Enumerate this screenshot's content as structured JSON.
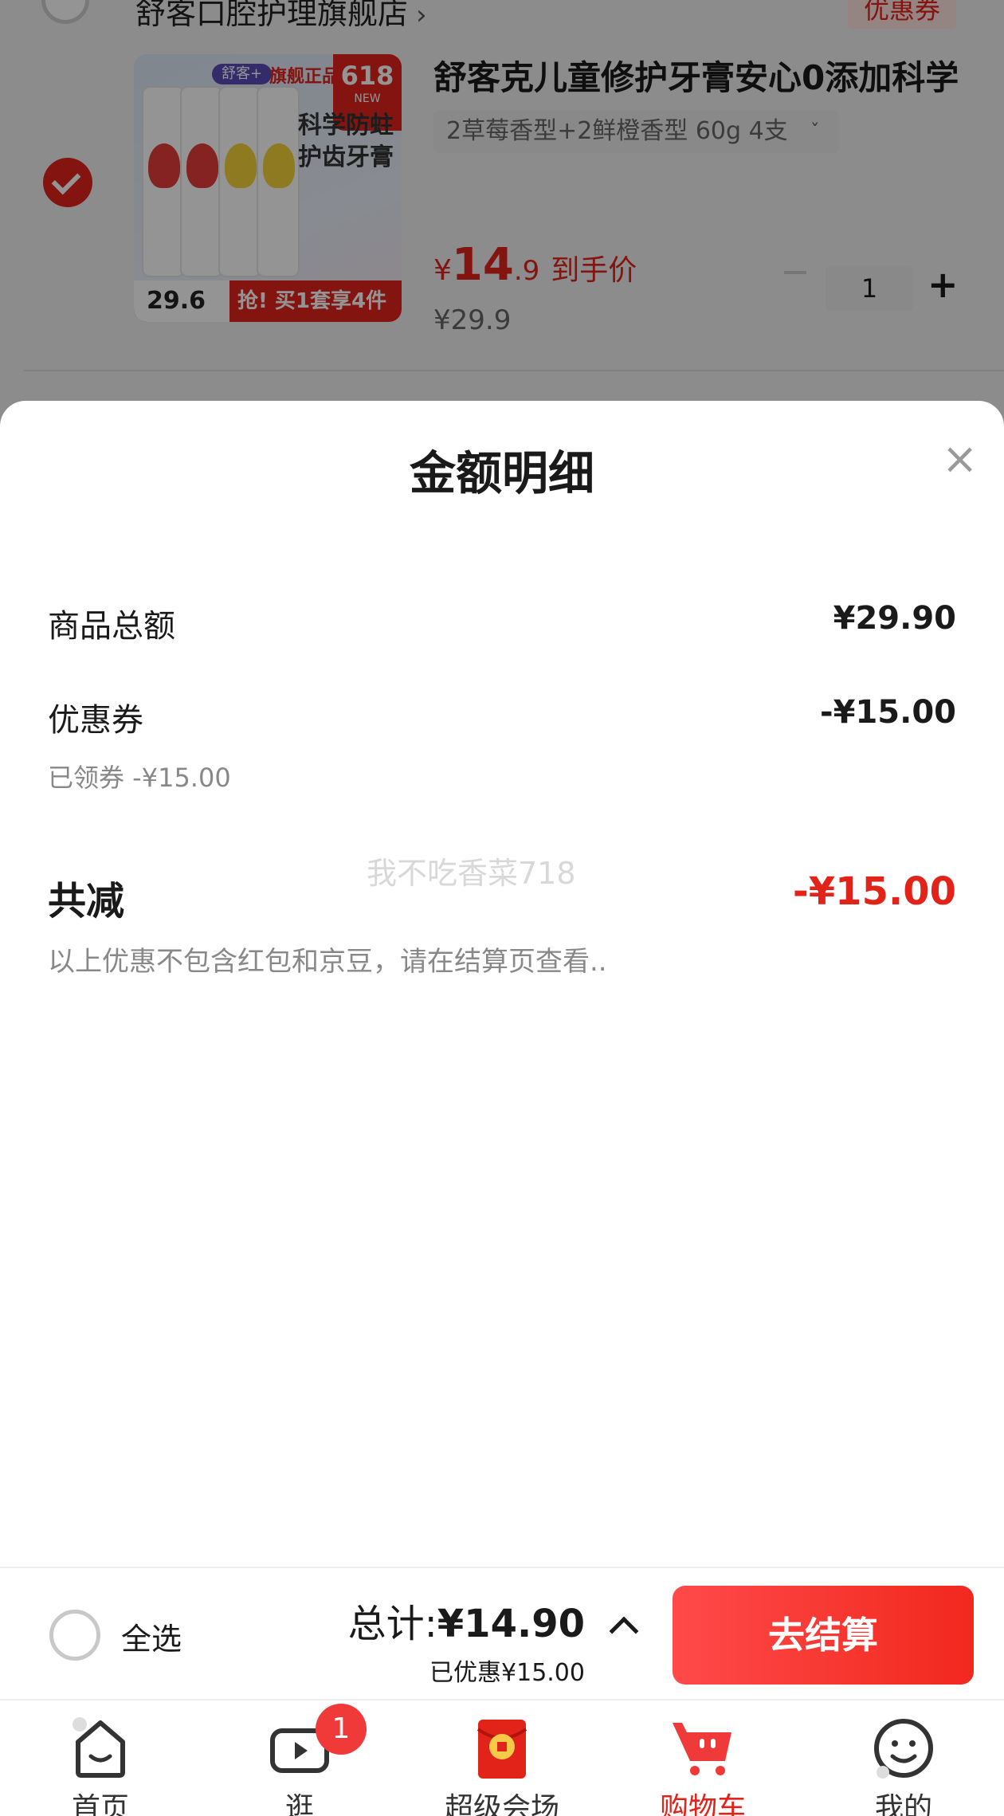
{
  "cart": {
    "store_name": "舒客口腔护理旗舰店",
    "store_arrow": "›",
    "coupon_tag": "优惠券",
    "product": {
      "title": "舒客克儿童修护牙膏安心0添加科学",
      "spec": "2草莓香型+2鲜橙香型 60g 4支",
      "spec_chevron": "ˇ",
      "price_yen": "¥",
      "price_int": "14",
      "price_dec": ".9",
      "price_label": "到手价",
      "original_price": "¥29.9",
      "quantity": "1",
      "qty_plus": "+",
      "image": {
        "badge_618": "618",
        "badge_new": "NEW",
        "brand_tag": "舒客+",
        "official_tag": "旗舰正品",
        "slogan": "科学防蛀护齿牙膏",
        "bottom_price": "29.6",
        "bottom_promo": "抢! 买1套享4件"
      }
    }
  },
  "sheet": {
    "title": "金额明细",
    "close_icon": "×",
    "lines": [
      {
        "label": "商品总额",
        "value": "¥29.90"
      },
      {
        "label": "优惠券",
        "value": "-¥15.00",
        "note": "已领券 -¥15.00"
      }
    ],
    "total": {
      "label": "共减",
      "value": "-¥15.00"
    },
    "disclaimer": "以上优惠不包含红包和京豆，请在结算页查看..",
    "watermark": "我不吃香菜718",
    "accent_color": "#e2231a"
  },
  "checkout": {
    "select_all": "全选",
    "total_prefix": "总计:",
    "total_value": "¥14.90",
    "saved_text": "已优惠¥15.00",
    "button_label": "去结算"
  },
  "tabbar": {
    "tabs": [
      {
        "label": "首页",
        "icon": "home-icon"
      },
      {
        "label": "逛",
        "icon": "video-icon",
        "badge": "1"
      },
      {
        "label": "超级会场",
        "icon": "red-envelope-icon"
      },
      {
        "label": "购物车",
        "icon": "cart-icon",
        "active": true
      },
      {
        "label": "我的",
        "icon": "smiley-icon"
      }
    ]
  }
}
